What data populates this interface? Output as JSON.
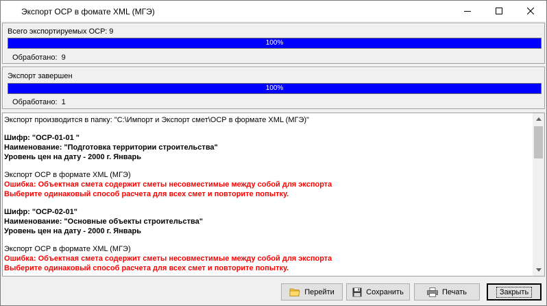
{
  "window": {
    "title": "Экспорт ОСР в фомате XML (МГЭ)",
    "controls": [
      "minimize-icon",
      "maximize-icon",
      "close-icon"
    ]
  },
  "total_group": {
    "caption": "Всего экспортируемых ОСР: 9",
    "progress": 1.0,
    "progress_label": "100%",
    "processed_label": "Обработано:",
    "processed_value": "9"
  },
  "status_group": {
    "caption": "Экспорт завершен",
    "progress": 1.0,
    "progress_label": "100%",
    "processed_label": "Обработано:",
    "processed_value": "1"
  },
  "log": {
    "header": "Экспорт производится в папку: \"C:\\Импорт и Экспорт смет\\ОСР в формате XML (МГЭ)\"",
    "entries": [
      {
        "cipher": "Шифр: \"ОСР-01-01 \"",
        "name": "Наименование: \"Подготовка территории строительства\"",
        "price_level": "Уровень цен на дату - 2000 г. Январь",
        "export_line": "Экспорт ОСР в формате XML (МГЭ)",
        "error_line1": "Ошибка: Объектная смета содержит сметы несовместимые между собой для экспорта",
        "error_line2": "Выберите одинаковый способ расчета для всех смет и повторите попытку."
      },
      {
        "cipher": "Шифр: \"ОСР-02-01\"",
        "name": "Наименование: \"Основные объекты строительства\"",
        "price_level": "Уровень цен на дату - 2000 г. Январь",
        "export_line": "Экспорт ОСР в формате XML (МГЭ)",
        "error_line1": "Ошибка: Объектная смета содержит сметы несовместимые между собой для экспорта",
        "error_line2": "Выберите одинаковый способ расчета для всех смет и повторите попытку."
      }
    ],
    "error_color": "#ff0000"
  },
  "buttons": {
    "go": "Перейти",
    "save": "Сохранить",
    "print": "Печать",
    "close": "Закрыть"
  },
  "colors": {
    "progress_fill": "#0000ff",
    "error_text": "#ff0000"
  },
  "icons": {
    "go": "folder-icon",
    "save": "floppy-disk-icon",
    "print": "printer-icon"
  }
}
